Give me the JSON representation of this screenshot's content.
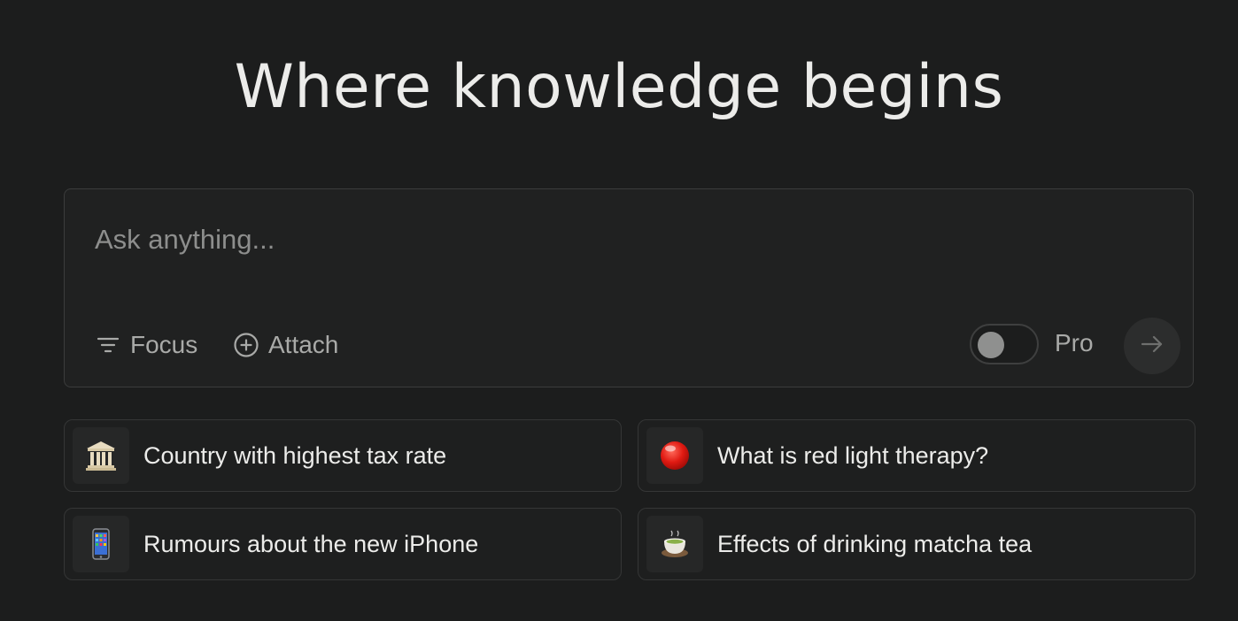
{
  "headline": "Where knowledge begins",
  "search": {
    "placeholder": "Ask anything..."
  },
  "toolbar": {
    "focus_label": "Focus",
    "attach_label": "Attach",
    "pro_label": "Pro",
    "pro_enabled": false
  },
  "icons": {
    "focus": "filter-icon",
    "attach": "plus-circle-icon",
    "submit": "arrow-right-icon"
  },
  "suggestions": [
    {
      "label": "Country with highest tax rate",
      "icon": "classical-building-icon"
    },
    {
      "label": "What is red light therapy?",
      "icon": "red-circle-icon"
    },
    {
      "label": "Rumours about the new iPhone",
      "icon": "mobile-phone-icon"
    },
    {
      "label": "Effects of drinking matcha tea",
      "icon": "tea-cup-icon"
    }
  ],
  "colors": {
    "background": "#1c1d1d",
    "input_background": "#202121",
    "text_primary": "#ececea",
    "text_muted": "#a9aaa8"
  }
}
